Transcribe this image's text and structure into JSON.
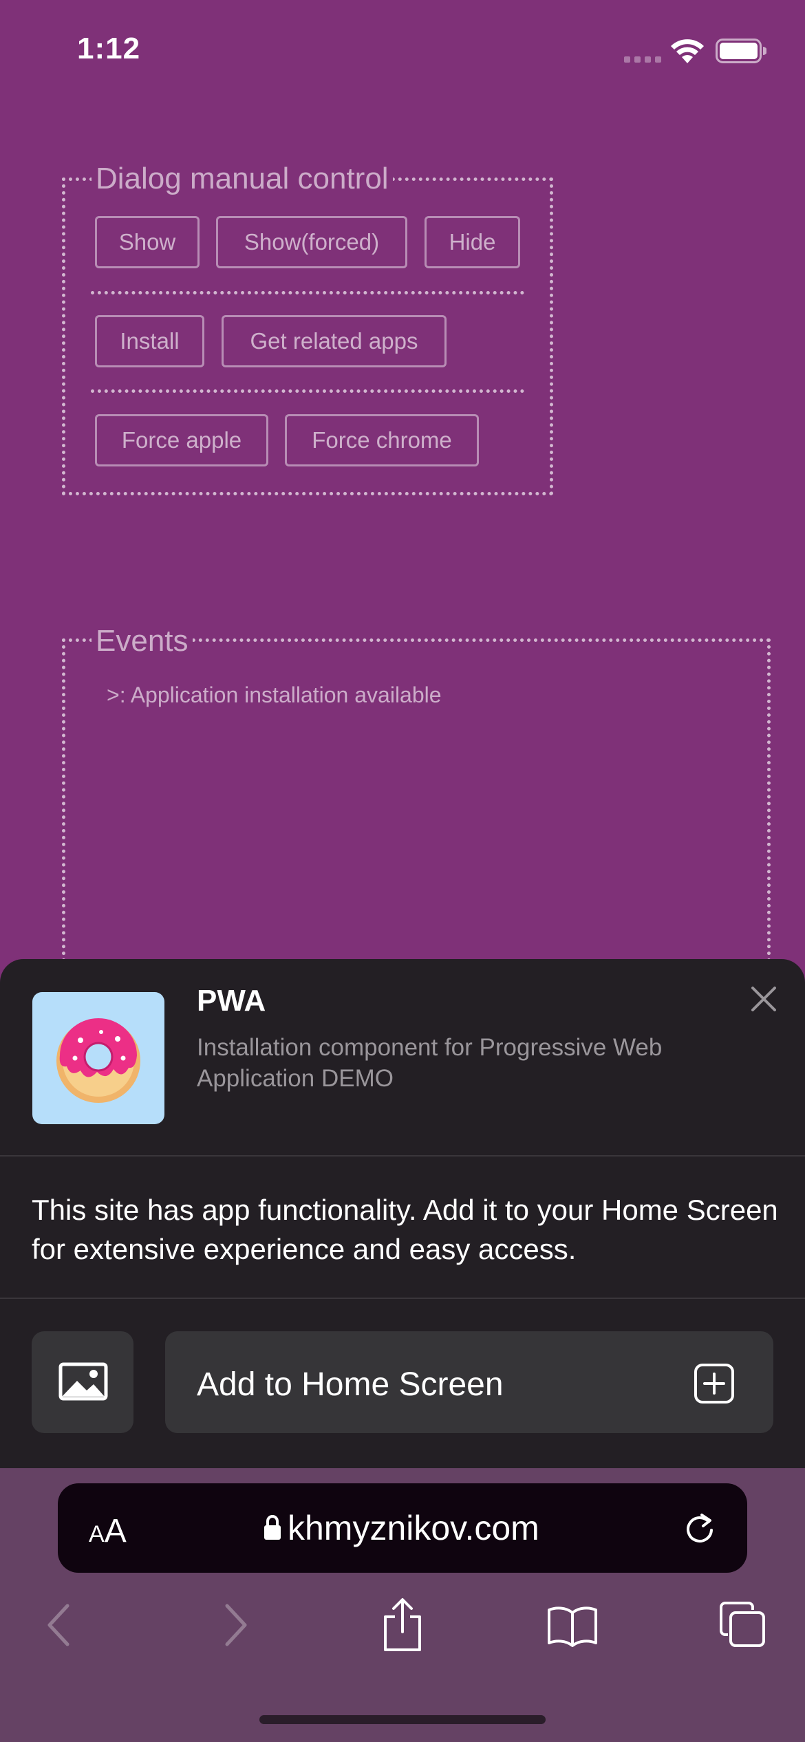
{
  "status_bar": {
    "time": "1:12"
  },
  "dialog_control": {
    "legend": "Dialog manual control",
    "buttons": {
      "show": "Show",
      "show_forced": "Show(forced)",
      "hide": "Hide",
      "install": "Install",
      "get_related_apps": "Get related apps",
      "force_apple": "Force apple",
      "force_chrome": "Force chrome"
    }
  },
  "events": {
    "legend": "Events",
    "lines": [
      ">: Application installation available"
    ]
  },
  "install_sheet": {
    "app_name": "PWA",
    "app_description": "Installation component for Progressive Web Application DEMO",
    "message": "This site has app functionality. Add it to your Home Screen for extensive experience and easy access.",
    "add_button_label": "Add to Home Screen",
    "icons": [
      "donut-icon",
      "close-icon",
      "image-icon",
      "plus-square-icon"
    ]
  },
  "browser": {
    "text_size_label_small": "A",
    "text_size_label_big": "A",
    "url": "khmyznikov.com",
    "icons": [
      "lock-icon",
      "reload-icon",
      "back-icon",
      "forward-icon",
      "share-icon",
      "bookmarks-icon",
      "tabs-icon"
    ]
  },
  "colors": {
    "page_background": "#7f3178",
    "sheet_background": "#231f24",
    "sheet_button": "#363538",
    "toolbar_background": "#654264",
    "url_bar": "#0f040f",
    "app_icon_background": "#b6defa"
  }
}
